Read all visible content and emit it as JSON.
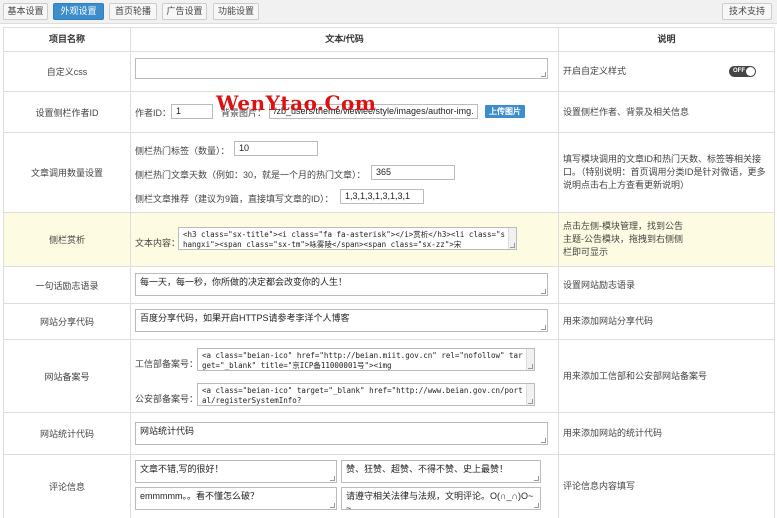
{
  "tabs": [
    {
      "label": "基本设置",
      "active": false
    },
    {
      "label": "外观设置",
      "active": true
    },
    {
      "label": "首页轮播",
      "active": false
    },
    {
      "label": "广告设置",
      "active": false
    },
    {
      "label": "功能设置",
      "active": false
    }
  ],
  "support_label": "技术支持",
  "columns": {
    "name": "项目名称",
    "code": "文本/代码",
    "desc": "说明"
  },
  "rows": {
    "custom_css": {
      "name": "自定义css",
      "value": "",
      "desc": "开启自定义样式",
      "toggle_label": "OFF"
    },
    "author": {
      "name": "设置侧栏作者ID",
      "id_label": "作者ID：",
      "id_value": "1",
      "bg_label": "背景图片：",
      "bg_value": "/zb_users/theme/viewlee/style/images/author-img.",
      "upload_label": "上传图片",
      "desc": "设置侧栏作者、背景及相关信息"
    },
    "count": {
      "name": "文章调用数量设置",
      "hot_tags_label": "侧栏热门标签（数量）：",
      "hot_tags_value": "10",
      "hot_days_label": "侧栏热门文章天数（例如：30，就是一个月的热门文章）：",
      "hot_days_value": "365",
      "recommend_label": "侧栏文章推荐（建议为9篇，直接填写文章的ID）：",
      "recommend_value": "1,3,1,3,1,3,1,3,1",
      "desc": "填写模块调用的文章ID和热门天数、标签等相关接口。（特别说明：首页调用分类ID是针对微语，更多说明点击右上方查看更新说明）"
    },
    "sidebar_appreciate": {
      "name": "侧栏赏析",
      "content_label": "文本内容：",
      "value": "<h3 class=\"sx-title\"><i class=\"fa fa-asterisk\"></i>赏析</h3><li class=\"shangxi\"><span class=\"sx-tm\">咏雾陵</span><span class=\"sx-zz\">宋",
      "desc": "点击左侧-模块管理，找到公告主题-公告模块，拖拽到右侧侧栏即可显示"
    },
    "motto": {
      "name": "一句话励志语录",
      "value": "每一天，每一秒，你所做的决定都会改变你的人生！",
      "desc": "设置网站励志语录"
    },
    "share": {
      "name": "网站分享代码",
      "value": "百度分享代码，如果开启HTTPS请参考李洋个人博客",
      "desc": "用来添加网站分享代码"
    },
    "beian": {
      "name": "网站备案号",
      "miit_label": "工信部备案号：",
      "miit_value": "<a class=\"beian-ico\" href=\"http://beian.miit.gov.cn\" rel=\"nofollow\" target=\"_blank\" title=\"京ICP备11000001号\"><img",
      "police_label": "公安部备案号：",
      "police_value": "<a class=\"beian-ico\" target=\"_blank\" href=\"http://www.beian.gov.cn/portal/registerSystemInfo?",
      "desc": "用来添加工信部和公安部网站备案号"
    },
    "stats": {
      "name": "网站统计代码",
      "value": "网站统计代码",
      "desc": "用来添加网站的统计代码"
    },
    "comment": {
      "name": "评论信息",
      "value1": "文章不错,写的很好！",
      "value2": "赞、狂赞、超赞、不得不赞、史上最赞！",
      "value3": "emmmmm。。看不懂怎么破？",
      "value4": "请遵守相关法律与法规，文明评论。O(∩_∩)O~~",
      "desc": "评论信息内容填写"
    }
  },
  "watermark": "WenYtao.Com",
  "colors": {
    "accent": "#3c8dcb",
    "highlight_row": "#fdfbe2",
    "watermark": "#dd1111"
  }
}
